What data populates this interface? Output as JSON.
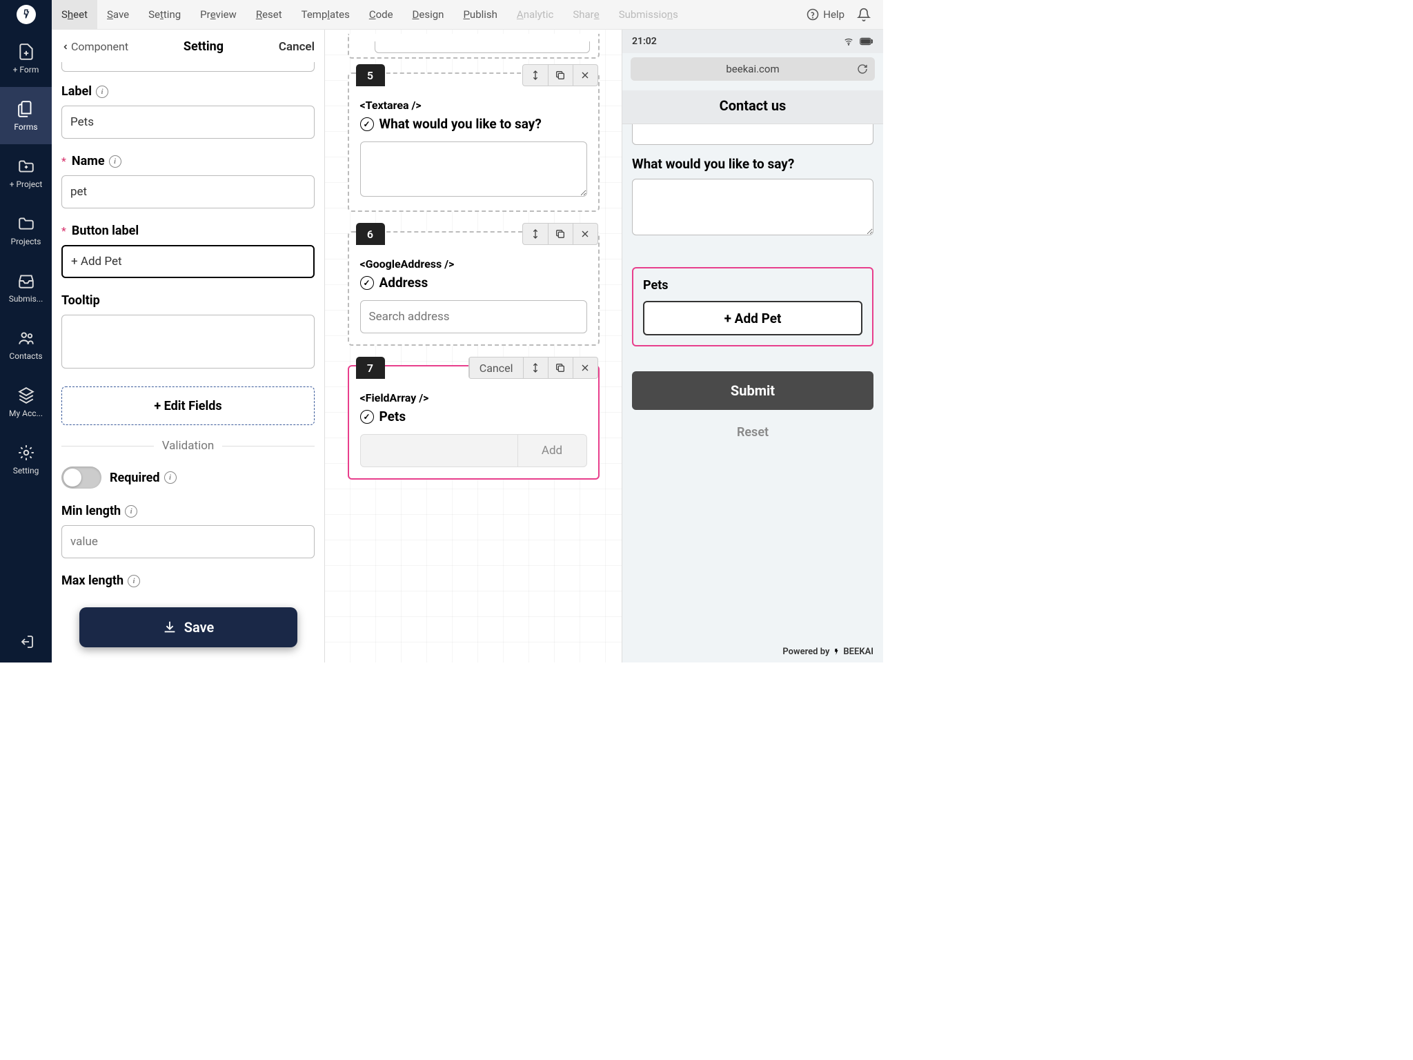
{
  "topbar": {
    "menu": [
      "Sheet",
      "Save",
      "Setting",
      "Preview",
      "Reset",
      "Templates",
      "Code",
      "Design",
      "Publish",
      "Analytic",
      "Share",
      "Submissions"
    ],
    "help": "Help"
  },
  "sidebar": {
    "items": [
      {
        "label": "+ Form"
      },
      {
        "label": "Forms"
      },
      {
        "label": "+ Project"
      },
      {
        "label": "Projects"
      },
      {
        "label": "Submis..."
      },
      {
        "label": "Contacts"
      },
      {
        "label": "My Acc..."
      },
      {
        "label": "Setting"
      }
    ]
  },
  "settings": {
    "back": "Component",
    "title": "Setting",
    "cancel": "Cancel",
    "labels": {
      "label": "Label",
      "name": "Name",
      "button_label": "Button label",
      "tooltip": "Tooltip",
      "edit_fields": "+ Edit Fields",
      "validation": "Validation",
      "required": "Required",
      "min_length": "Min length",
      "max_length": "Max length"
    },
    "values": {
      "label": "Pets",
      "name": "pet",
      "button_label": "+ Add Pet",
      "tooltip": "",
      "min_length_placeholder": "value"
    },
    "save": "Save"
  },
  "components": [
    {
      "num": "5",
      "tag": "<Textarea />",
      "title": "What would you like to say?",
      "type": "textarea"
    },
    {
      "num": "6",
      "tag": "<GoogleAddress />",
      "title": "Address",
      "type": "input",
      "placeholder": "Search address"
    },
    {
      "num": "7",
      "tag": "<FieldArray />",
      "title": "Pets",
      "type": "fieldarray",
      "add_label": "Add",
      "cancel": "Cancel",
      "selected": true
    }
  ],
  "preview": {
    "time": "21:02",
    "url": "beekai.com",
    "page_title": "Contact us",
    "q_label": "What would you like to say?",
    "pets_label": "Pets",
    "add_pet": "+ Add Pet",
    "submit": "Submit",
    "reset": "Reset",
    "footer_prefix": "Powered by",
    "footer_brand": "BEEKAI"
  }
}
